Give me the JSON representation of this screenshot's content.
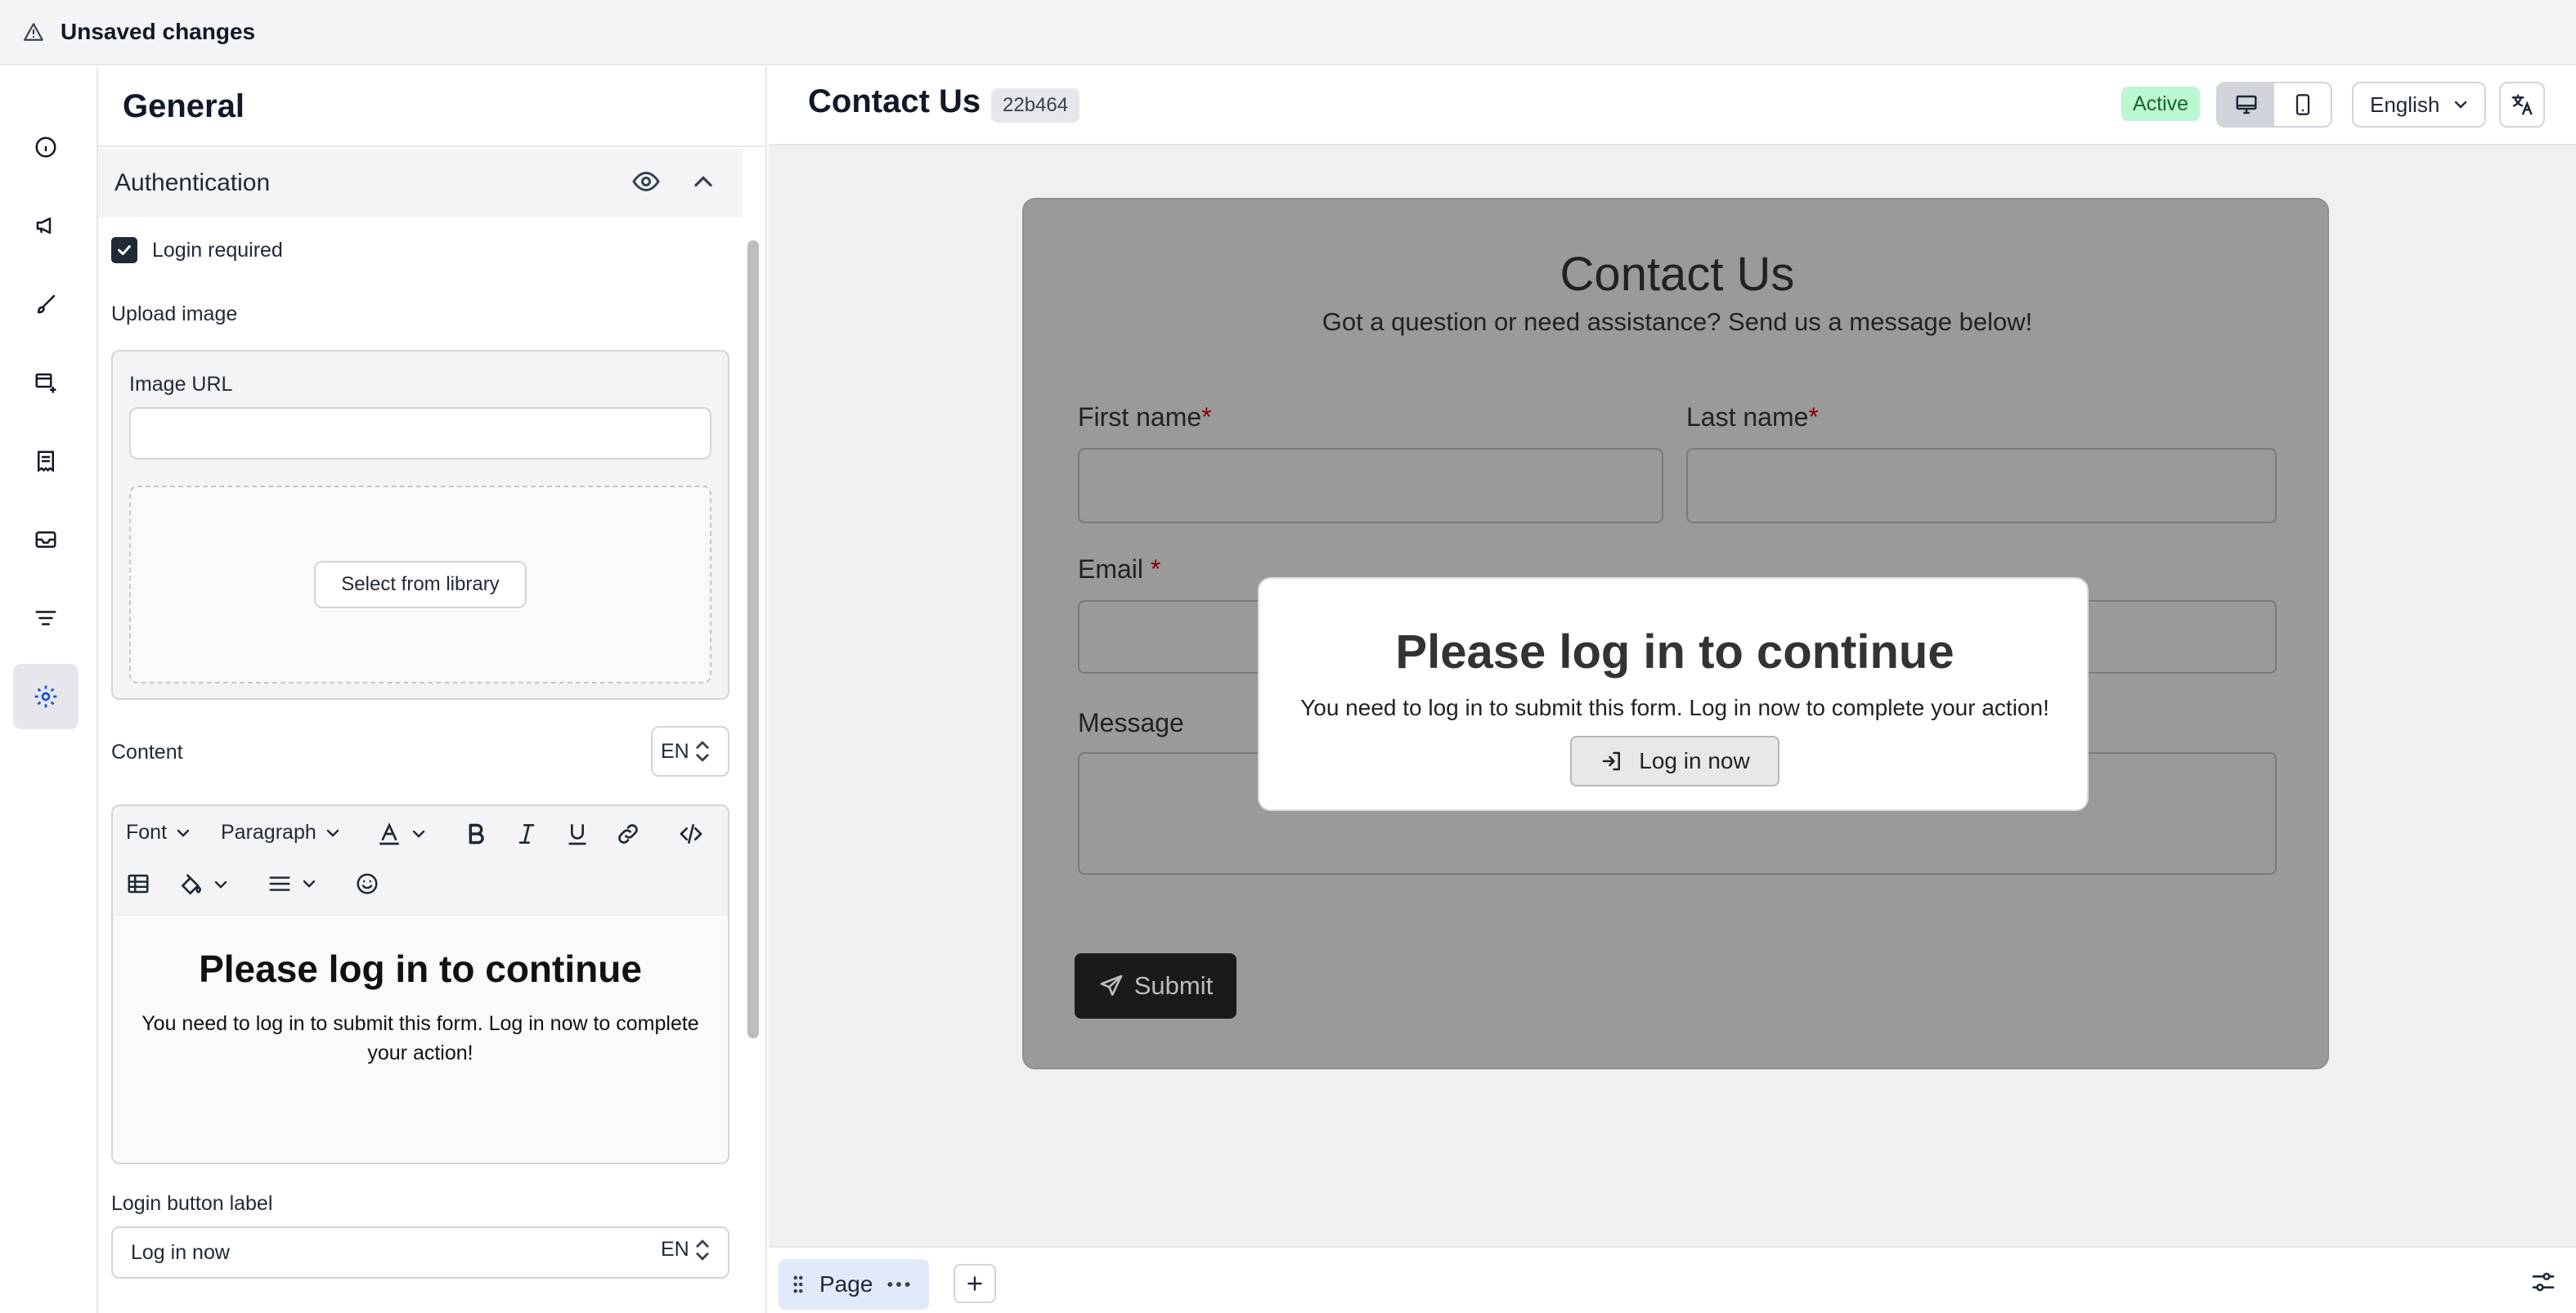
{
  "topbar": {
    "warning_text": "Unsaved changes"
  },
  "rail": {
    "items": [
      {
        "icon": "info-icon"
      },
      {
        "icon": "megaphone-icon"
      },
      {
        "icon": "brush-icon"
      },
      {
        "icon": "add-card-icon"
      },
      {
        "icon": "receipt-icon"
      },
      {
        "icon": "mail-icon"
      },
      {
        "icon": "filter-icon"
      },
      {
        "icon": "gear-icon",
        "active": true
      }
    ]
  },
  "panel": {
    "title": "General",
    "section": {
      "label": "Authentication",
      "expanded": true
    },
    "login_required": {
      "label": "Login required",
      "checked": true
    },
    "upload_label": "Upload image",
    "image_url": {
      "label": "Image URL",
      "value": ""
    },
    "library_button": "Select from library",
    "content_label": "Content",
    "content_lang": "EN",
    "toolbar": {
      "font": "Font",
      "paragraph": "Paragraph"
    },
    "editor": {
      "title": "Please log in to continue",
      "body": "You need to log in to submit this form. Log in now to complete your action!"
    },
    "login_button_label": {
      "label": "Login button label",
      "value": "Log in now",
      "lang": "EN"
    }
  },
  "preview": {
    "title": "Contact Us",
    "id_badge": "22b464",
    "status": "Active",
    "language": "English",
    "form": {
      "title": "Contact Us",
      "subtitle": "Got a question or need assistance? Send us a message below!",
      "first_name": "First name",
      "last_name": "Last name",
      "email": "Email",
      "message": "Message",
      "required_mark": "*",
      "submit": "Submit"
    },
    "overlay": {
      "title": "Please log in to continue",
      "body": "You need to log in to submit this form. Log in now to complete your action!",
      "button": "Log in now"
    },
    "page_tab": "Page"
  },
  "colors": {
    "accent": "#1d4ed8",
    "active_badge_bg": "#bbf7d0",
    "active_badge_text": "#166534",
    "form_overlay": "#9a9a9a",
    "required": "#8b0000"
  }
}
